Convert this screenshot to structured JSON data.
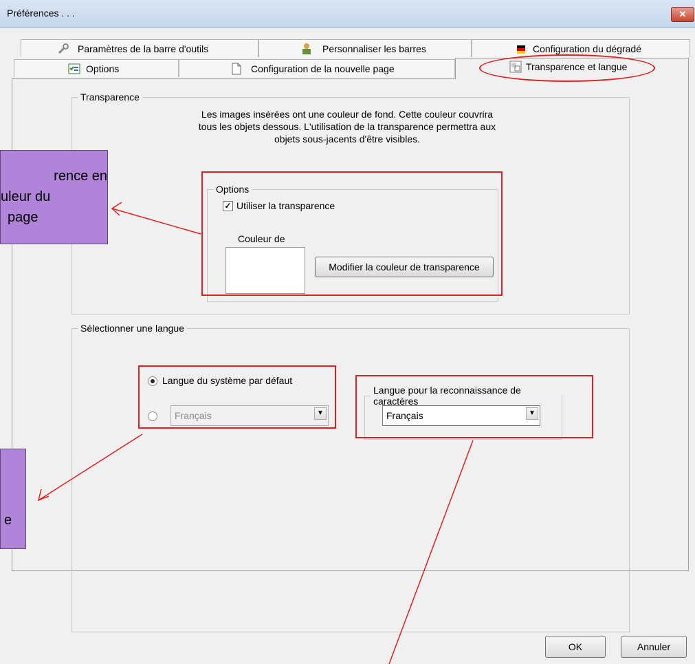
{
  "window": {
    "title": "Préférences . . .",
    "close_glyph": "✕"
  },
  "tabs": {
    "row1": [
      {
        "label": "Paramètres de la barre d'outils",
        "icon": "wrench-icon"
      },
      {
        "label": "Personnaliser les barres",
        "icon": "person-icon"
      },
      {
        "label": "Configuration du dégradé",
        "icon": "flag-icon"
      }
    ],
    "row2": [
      {
        "label": "Options",
        "icon": "options-icon"
      },
      {
        "label": "Configuration de la nouvelle page",
        "icon": "page-icon"
      },
      {
        "label": "Transparence et langue",
        "icon": "transparency-icon",
        "active": true
      }
    ]
  },
  "transparence": {
    "legend": "Transparence",
    "description": [
      "Les images insérées ont une couleur de fond. Cette couleur couvrira",
      "tous les objets dessous. L'utilisation de la transparence permettra aux",
      "objets sous-jacents d'être visibles."
    ],
    "options_legend": "Options",
    "use_transparency_label": "Utiliser la transparence",
    "use_transparency_checked": true,
    "check_glyph": "✓",
    "color_label": "Couleur de",
    "modify_color_button": "Modifier la couleur de transparence",
    "swatch_color": "#ffffff"
  },
  "langue": {
    "legend": "Sélectionner une langue",
    "default_radio_label": "Langue du système par défaut",
    "custom_select_value": "Français",
    "ocr_legend": "Langue pour la reconnaissance de caractères",
    "ocr_select_value": "Français",
    "dropdown_glyph": "▼"
  },
  "footer": {
    "ok": "OK",
    "cancel": "Annuler"
  },
  "callouts": {
    "transparency_lines": [
      "rence en",
      "uleur du",
      "page"
    ],
    "language_lines": [
      "e"
    ]
  },
  "colors": {
    "annotation_red": "#e02020",
    "callout_purple": "#b084d8"
  }
}
